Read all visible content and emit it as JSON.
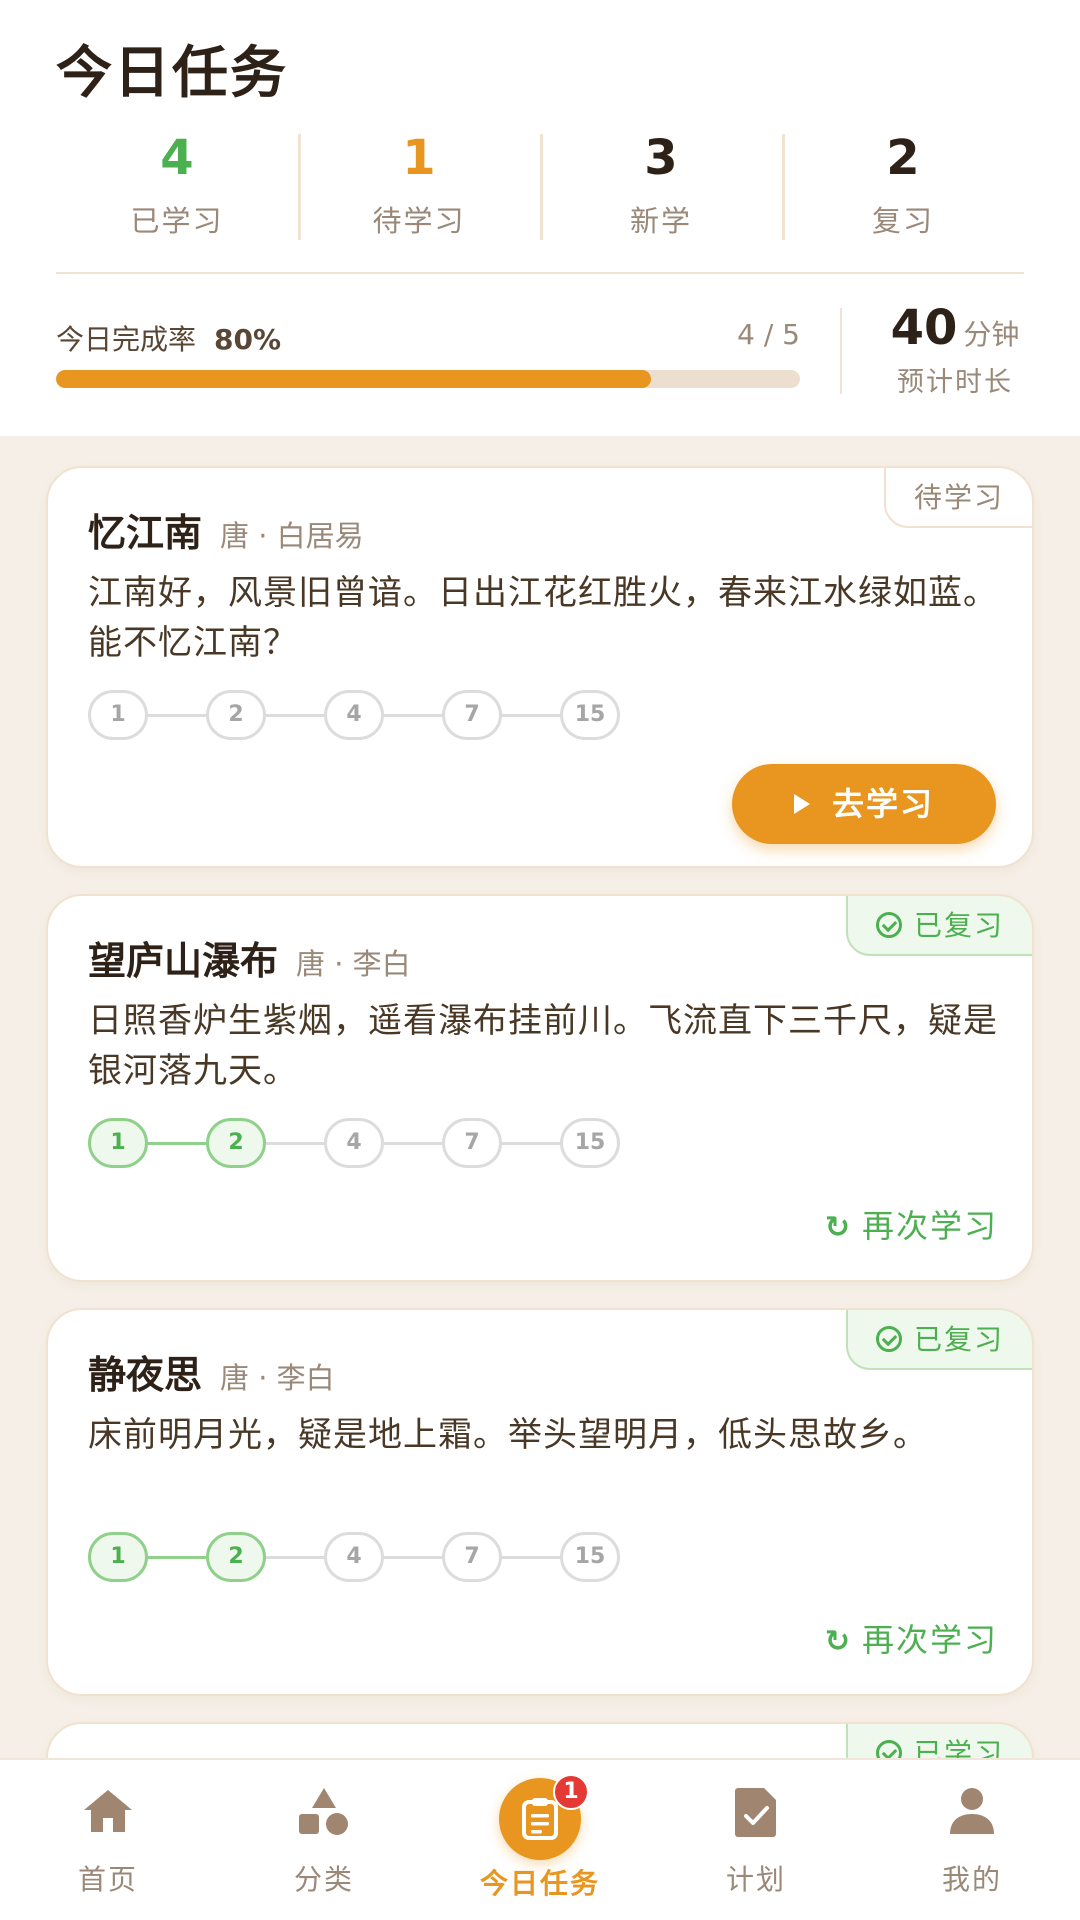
{
  "header": {
    "title": "今日任务",
    "stats": [
      {
        "value": "4",
        "label": "已学习"
      },
      {
        "value": "1",
        "label": "待学习"
      },
      {
        "value": "3",
        "label": "新学"
      },
      {
        "value": "2",
        "label": "复习"
      }
    ],
    "completion": {
      "label": "今日完成率",
      "percent_text": "80%",
      "percent": 80,
      "count": "4 / 5"
    },
    "duration": {
      "value": "40",
      "unit": "分钟",
      "label": "预计时长"
    }
  },
  "cards": [
    {
      "title": "忆江南",
      "meta": "唐 · 白居易",
      "text": "江南好，风景旧曾谙。日出江花红胜火，春来江水绿如蓝。能不忆江南？",
      "badge": "待学习",
      "badge_state": "pending",
      "steps": [
        "1",
        "2",
        "4",
        "7",
        "15"
      ],
      "steps_done": 0,
      "action": "去学习"
    },
    {
      "title": "望庐山瀑布",
      "meta": "唐 · 李白",
      "text": "日照香炉生紫烟，遥看瀑布挂前川。飞流直下三千尺，疑是银河落九天。",
      "badge": "已复习",
      "badge_state": "done",
      "steps": [
        "1",
        "2",
        "4",
        "7",
        "15"
      ],
      "steps_done": 2,
      "action": "再次学习"
    },
    {
      "title": "静夜思",
      "meta": "唐 · 李白",
      "text": "床前明月光，疑是地上霜。举头望明月，低头思故乡。",
      "badge": "已复习",
      "badge_state": "done",
      "steps": [
        "1",
        "2",
        "4",
        "7",
        "15"
      ],
      "steps_done": 2,
      "action": "再次学习"
    },
    {
      "badge": "已学习",
      "badge_state": "done"
    }
  ],
  "nav": {
    "items": [
      {
        "label": "首页",
        "icon": "home-icon"
      },
      {
        "label": "分类",
        "icon": "category-icon"
      },
      {
        "label": "今日任务",
        "icon": "task-clipboard-icon",
        "badge": "1",
        "active": true
      },
      {
        "label": "计划",
        "icon": "plan-icon"
      },
      {
        "label": "我的",
        "icon": "profile-icon"
      }
    ]
  },
  "colors": {
    "accent": "#e8961f",
    "success": "#4caf50",
    "background": "#f5efe7",
    "notification": "#e53935"
  }
}
